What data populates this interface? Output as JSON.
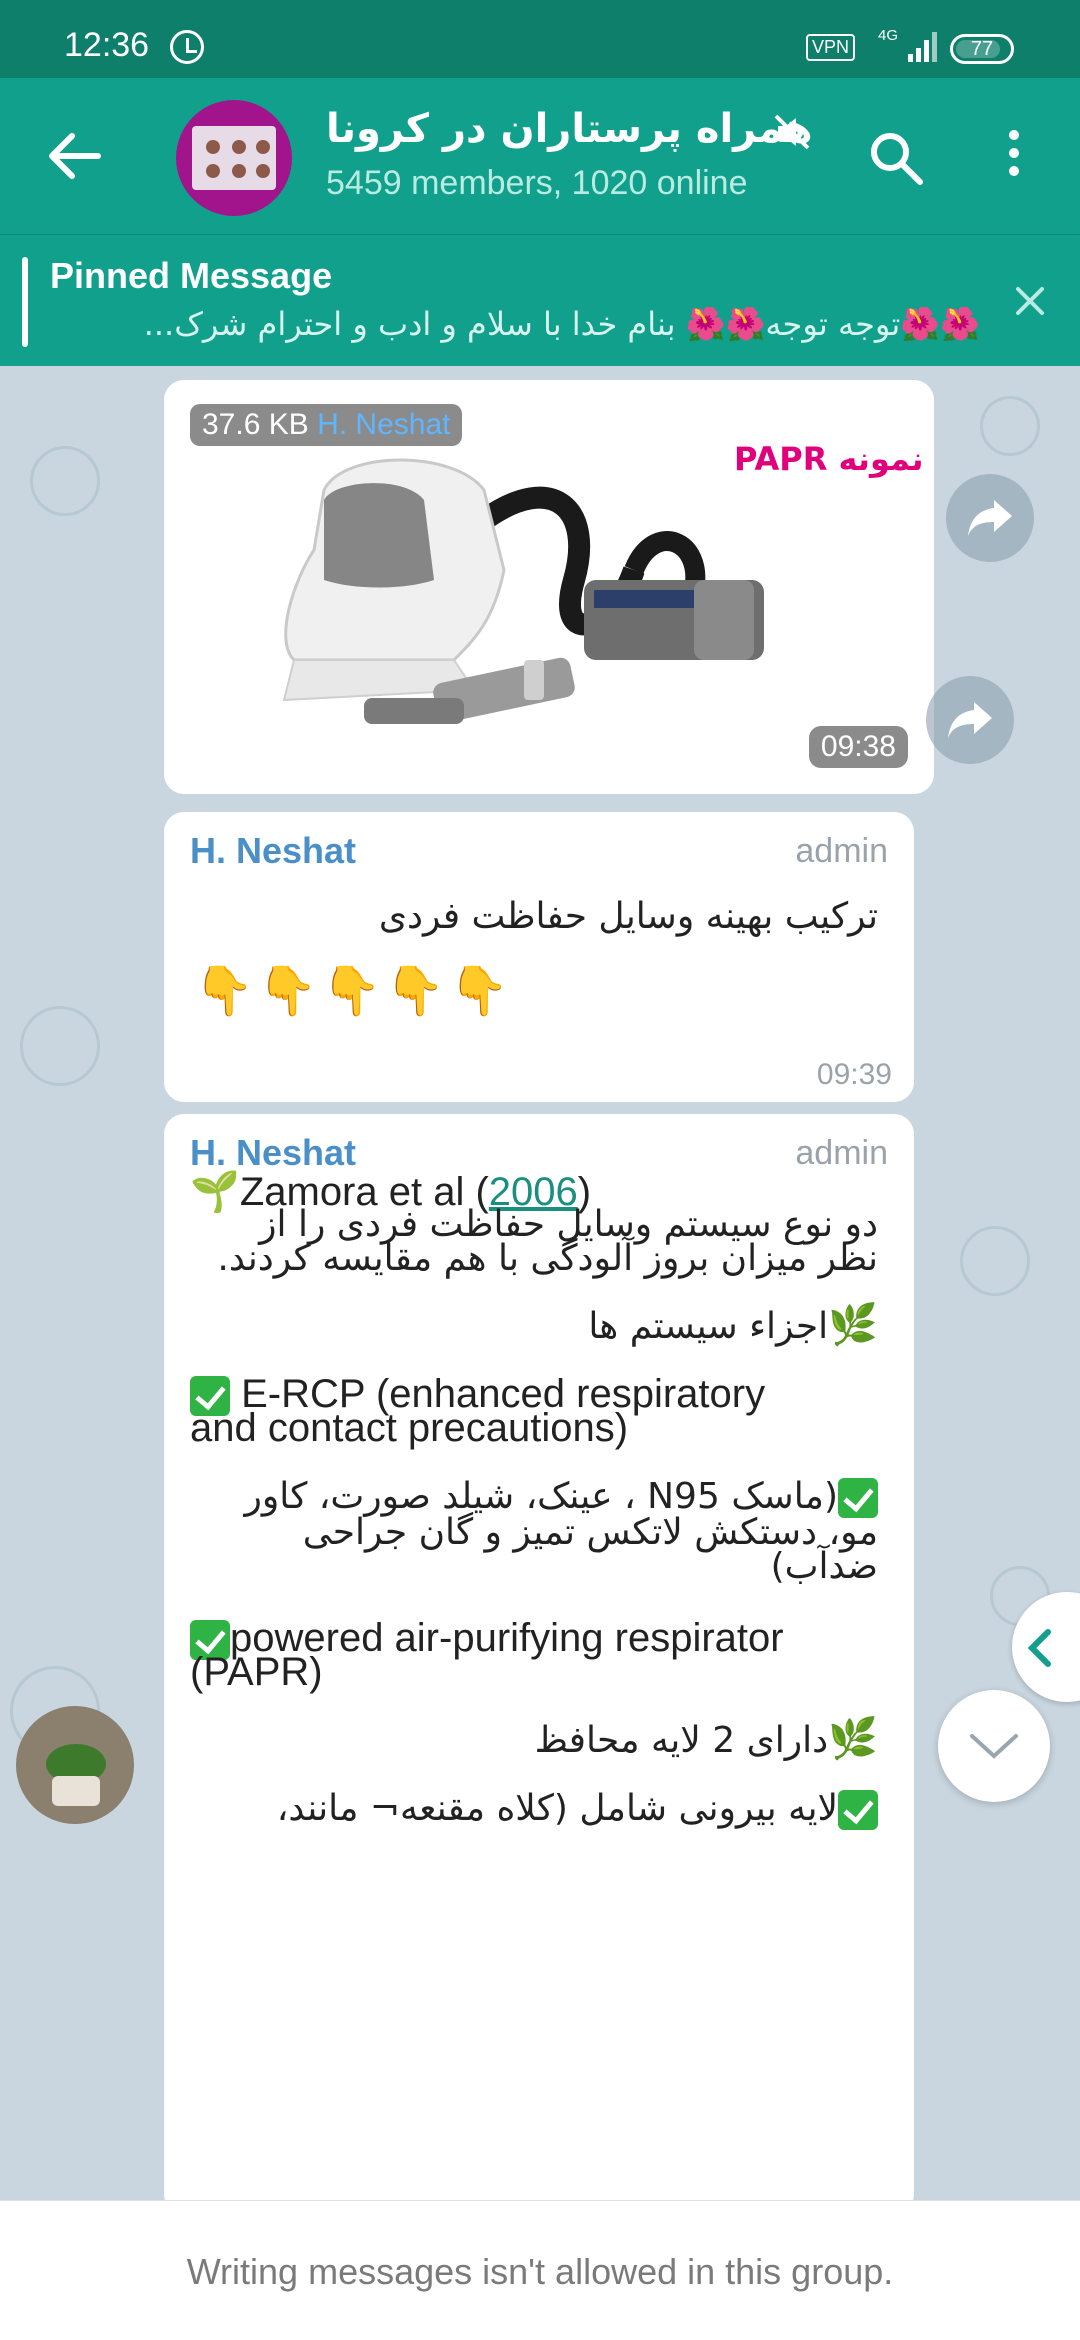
{
  "status_bar": {
    "time": "12:36",
    "vpn": "VPN",
    "network": "4G",
    "battery": "77"
  },
  "header": {
    "title": "همراه پرستاران در کرونا",
    "subtitle": "5459 members, 1020 online"
  },
  "pinned": {
    "title": "Pinned Message",
    "text": "🌺🌺توجه توجه🌺🌺  بنام خدا  با سلام و ادب و احترام  شرک..."
  },
  "photo_message": {
    "size": "37.6 KB",
    "sender": "H. Neshat",
    "image_label": "نمونه PAPR",
    "time": "09:38"
  },
  "message1": {
    "sender": "H. Neshat",
    "role": "admin",
    "text": "ترکیب بهینه وسایل حفاظت فردی",
    "emojis": "👇👇👇👇👇",
    "time": "09:39"
  },
  "message2": {
    "sender": "H. Neshat",
    "role": "admin",
    "title_prefix": "Zamora  et al ",
    "title_open": "(",
    "title_ref": "2006",
    "title_close": ")",
    "intro_line1": "دو نوع سیستم وسایل حفاظت فردی را از",
    "intro_line2": "نظر میزان بروز آلودگی با هم مقایسه کردند.",
    "components_heading": "اجزاء سیستم ها",
    "erc_line1": "E-RCP (enhanced respiratory",
    "erc_line2": "and contact precautions)",
    "n95_line1": "(ماسک N95 ، عینک، شیلد صورت، کاور",
    "n95_line2": "مو، دستکش لاتکس تمیز و گان جراحی",
    "n95_line3": "ضدآب)",
    "papr_line1": "powered air-purifying respirator",
    "papr_line2": "(PAPR)",
    "layers_heading": "دارای 2 لایه محافظ",
    "outer_layer": "لایه بیرونی شامل (کلاه مقنعه¬ مانند،"
  },
  "bottom": {
    "notice": "Writing messages isn't allowed in this group."
  },
  "colors": {
    "header": "#11a08c",
    "statusbar": "#0d7f6a",
    "chat_bg": "#c9d6df",
    "sender": "#4a8fc8",
    "check": "#2fb344"
  },
  "icons": [
    "alarm-icon",
    "back-arrow-icon",
    "mute-icon",
    "search-icon",
    "more-vert-icon",
    "close-icon",
    "forward-icon",
    "chevron-left-icon",
    "chevron-down-icon",
    "check-icon",
    "leaf-icon",
    "seedling-icon"
  ]
}
